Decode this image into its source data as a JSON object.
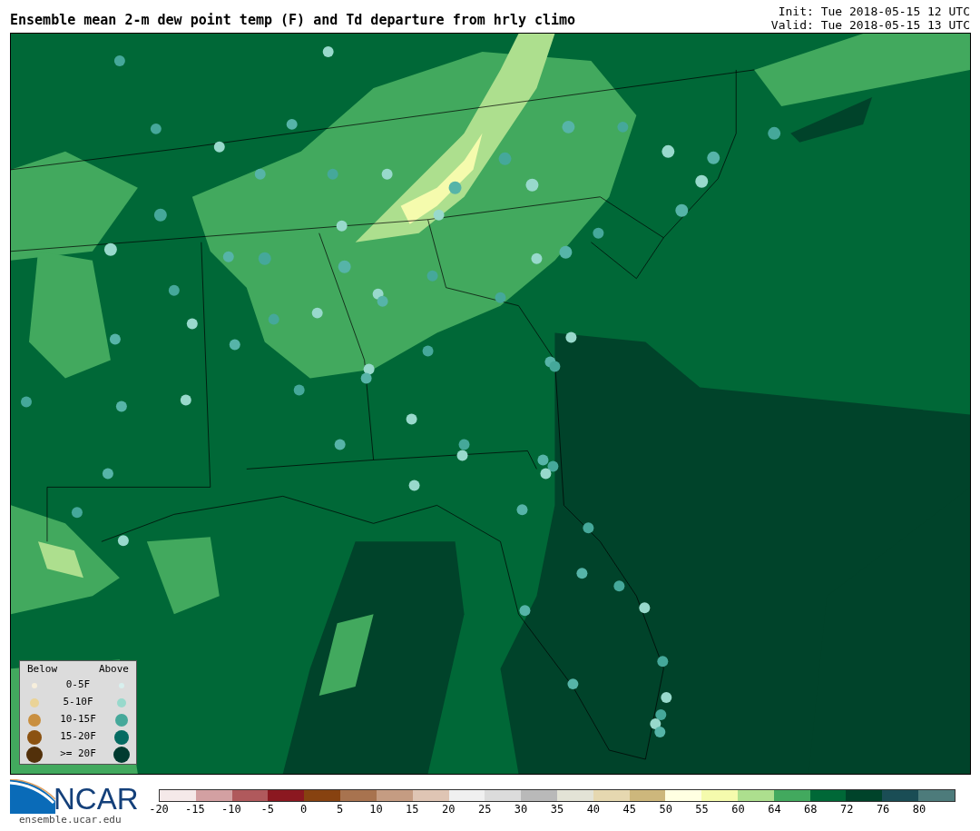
{
  "title": "Ensemble mean 2-m dew point temp (F) and Td departure from hrly climo",
  "init": "Init: Tue 2018-05-15 12 UTC",
  "valid": "Valid: Tue 2018-05-15 13 UTC",
  "legend": {
    "below_heading": "Below",
    "above_heading": "Above",
    "rows": [
      {
        "label": "0-5F",
        "below": {
          "color": "#f7efdc"
        },
        "above": {
          "color": "#d8f0ee"
        }
      },
      {
        "label": "5-10F",
        "below": {
          "color": "#ead397"
        },
        "above": {
          "color": "#98d9cc"
        }
      },
      {
        "label": "10-15F",
        "below": {
          "color": "#c98f3f"
        },
        "above": {
          "color": "#45a89a"
        }
      },
      {
        "label": "15-20F",
        "below": {
          "color": "#8b5211"
        },
        "above": {
          "color": "#056b62"
        }
      },
      {
        "label": ">= 20F",
        "below": {
          "color": "#52300a"
        },
        "above": {
          "color": "#013b30"
        }
      }
    ]
  },
  "logo": {
    "wordmark": "NCAR",
    "url": "ensemble.ucar.edu"
  },
  "colorbar": [
    {
      "label": "-20",
      "color": "#f5e9e9"
    },
    {
      "label": "-15",
      "color": "#d3a0a2"
    },
    {
      "label": "-10",
      "color": "#b0595c"
    },
    {
      "label": "-5",
      "color": "#8b1820"
    },
    {
      "label": "0",
      "color": "#874210"
    },
    {
      "label": "5",
      "color": "#a8734f"
    },
    {
      "label": "10",
      "color": "#c59c82"
    },
    {
      "label": "15",
      "color": "#dfc5b4"
    },
    {
      "label": "20",
      "color": "#f0f0f0"
    },
    {
      "label": "25",
      "color": "#dcdcdc"
    },
    {
      "label": "30",
      "color": "#b9b9b9"
    },
    {
      "label": "35",
      "color": "#e3e3d6"
    },
    {
      "label": "40",
      "color": "#e6d8b0"
    },
    {
      "label": "45",
      "color": "#cdb77c"
    },
    {
      "label": "50",
      "color": "#ffffe2"
    },
    {
      "label": "55",
      "color": "#f5fbad"
    },
    {
      "label": "60",
      "color": "#addf8e"
    },
    {
      "label": "64",
      "color": "#42a95e"
    },
    {
      "label": "68",
      "color": "#006837"
    },
    {
      "label": "72",
      "color": "#00432a"
    },
    {
      "label": "76",
      "color": "#1a4d55"
    },
    {
      "label": "80",
      "color": "#4d7b7b"
    }
  ]
}
